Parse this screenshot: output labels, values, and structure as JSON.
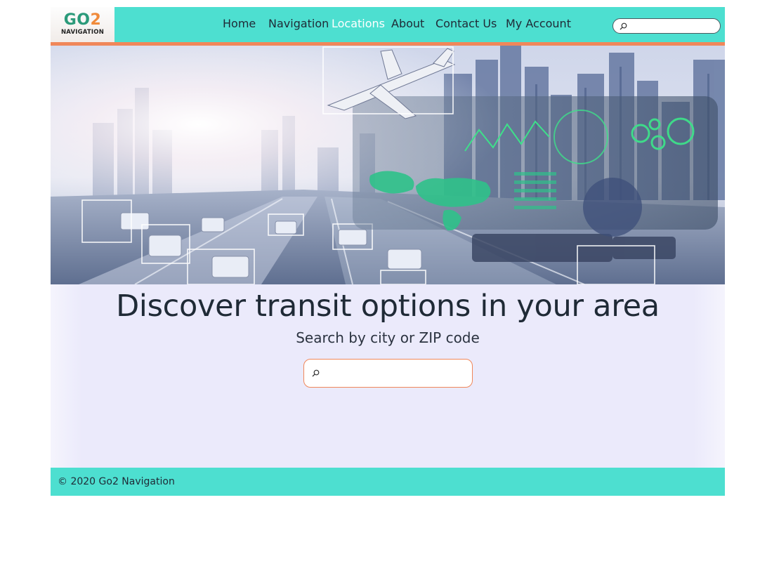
{
  "header": {
    "logo": {
      "mark_part1": "GO",
      "mark_part2": "2",
      "subtitle": "NAVIGATION"
    },
    "nav": [
      {
        "label": "Home",
        "active": false
      },
      {
        "label": "Navigation",
        "active": false
      },
      {
        "label": "Locations",
        "active": true
      },
      {
        "label": "About",
        "active": false
      },
      {
        "label": "Contact Us",
        "active": false
      },
      {
        "label": "My Account",
        "active": false
      }
    ],
    "search": {
      "value": "",
      "placeholder": "",
      "icon": "search-icon"
    }
  },
  "hero": {
    "image": "highway-city-airplane-logistics-banner",
    "icons": [
      "airplane-icon",
      "world-map-icon",
      "gears-icon",
      "line-graph-icon"
    ]
  },
  "main": {
    "heading": "Discover transit options in your area",
    "subtitle": "Search by city or ZIP code",
    "search": {
      "value": "",
      "placeholder": "",
      "icon": "search-icon"
    }
  },
  "footer": {
    "copyright": "© 2020 Go2 Navigation"
  },
  "colors": {
    "header_bg": "#4ddfd0",
    "accent_orange": "#f0875a",
    "main_bg": "#ebeafb",
    "text_dark": "#1f2a36",
    "nav_active": "#ffffff"
  }
}
